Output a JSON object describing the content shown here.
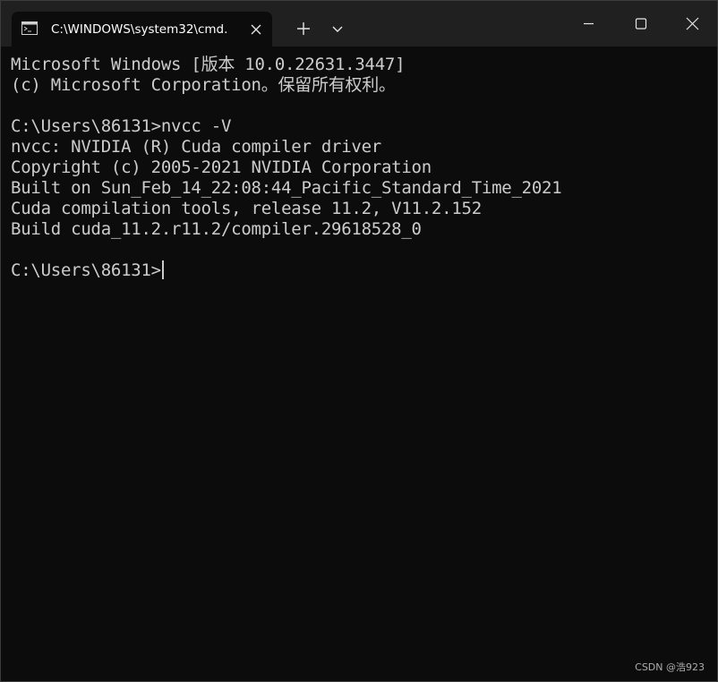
{
  "tab": {
    "title": "C:\\WINDOWS\\system32\\cmd.",
    "icon": "console-icon"
  },
  "toolbar": {
    "new_tab_icon": "plus-icon",
    "dropdown_icon": "chevron-down-icon"
  },
  "window_controls": {
    "minimize_icon": "minimize-icon",
    "maximize_icon": "maximize-icon",
    "close_icon": "close-icon"
  },
  "terminal": {
    "lines": [
      "Microsoft Windows [版本 10.0.22631.3447]",
      "(c) Microsoft Corporation。保留所有权利。",
      "",
      "C:\\Users\\86131>nvcc -V",
      "nvcc: NVIDIA (R) Cuda compiler driver",
      "Copyright (c) 2005-2021 NVIDIA Corporation",
      "Built on Sun_Feb_14_22:08:44_Pacific_Standard_Time_2021",
      "Cuda compilation tools, release 11.2, V11.2.152",
      "Build cuda_11.2.r11.2/compiler.29618528_0",
      "",
      "C:\\Users\\86131>"
    ]
  },
  "watermark": "CSDN @浩923",
  "colors": {
    "terminal_bg": "#0c0c0c",
    "titlebar_bg": "#202020",
    "text": "#cccccc"
  }
}
